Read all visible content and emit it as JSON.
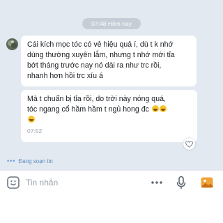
{
  "chat": {
    "date_divider": "07:48 Hôm nay",
    "messages": [
      {
        "lines": [
          "Cái kích mọc tóc có vẻ hiệu quả í, dù t k nhớ",
          "dùng thường xuyên lắm, nhưng t nhớ mới tỉa",
          "bớt tháng trước nay nó dài ra như trc rồi,",
          "nhanh hơn hồi trc xíu á"
        ]
      },
      {
        "lines": [
          "Mà t chuẩn bị tỉa rồi, do trời này nóng quá,",
          "tóc ngang cổ hầm hầm t ngủ hong đc"
        ],
        "emoji": "laughing-tears-emoji",
        "time": "07:52"
      }
    ],
    "typing_indicator": "Đang soạn tin"
  },
  "input_bar": {
    "placeholder": "Tin nhắn",
    "icons": [
      "emoji-icon",
      "more-icon",
      "microphone-icon",
      "image-icon"
    ]
  },
  "colors": {
    "background": "#e2e9f1",
    "bubble": "#ffffff",
    "accent": "#5b9bd5",
    "image_icon": "#f0a33a"
  }
}
